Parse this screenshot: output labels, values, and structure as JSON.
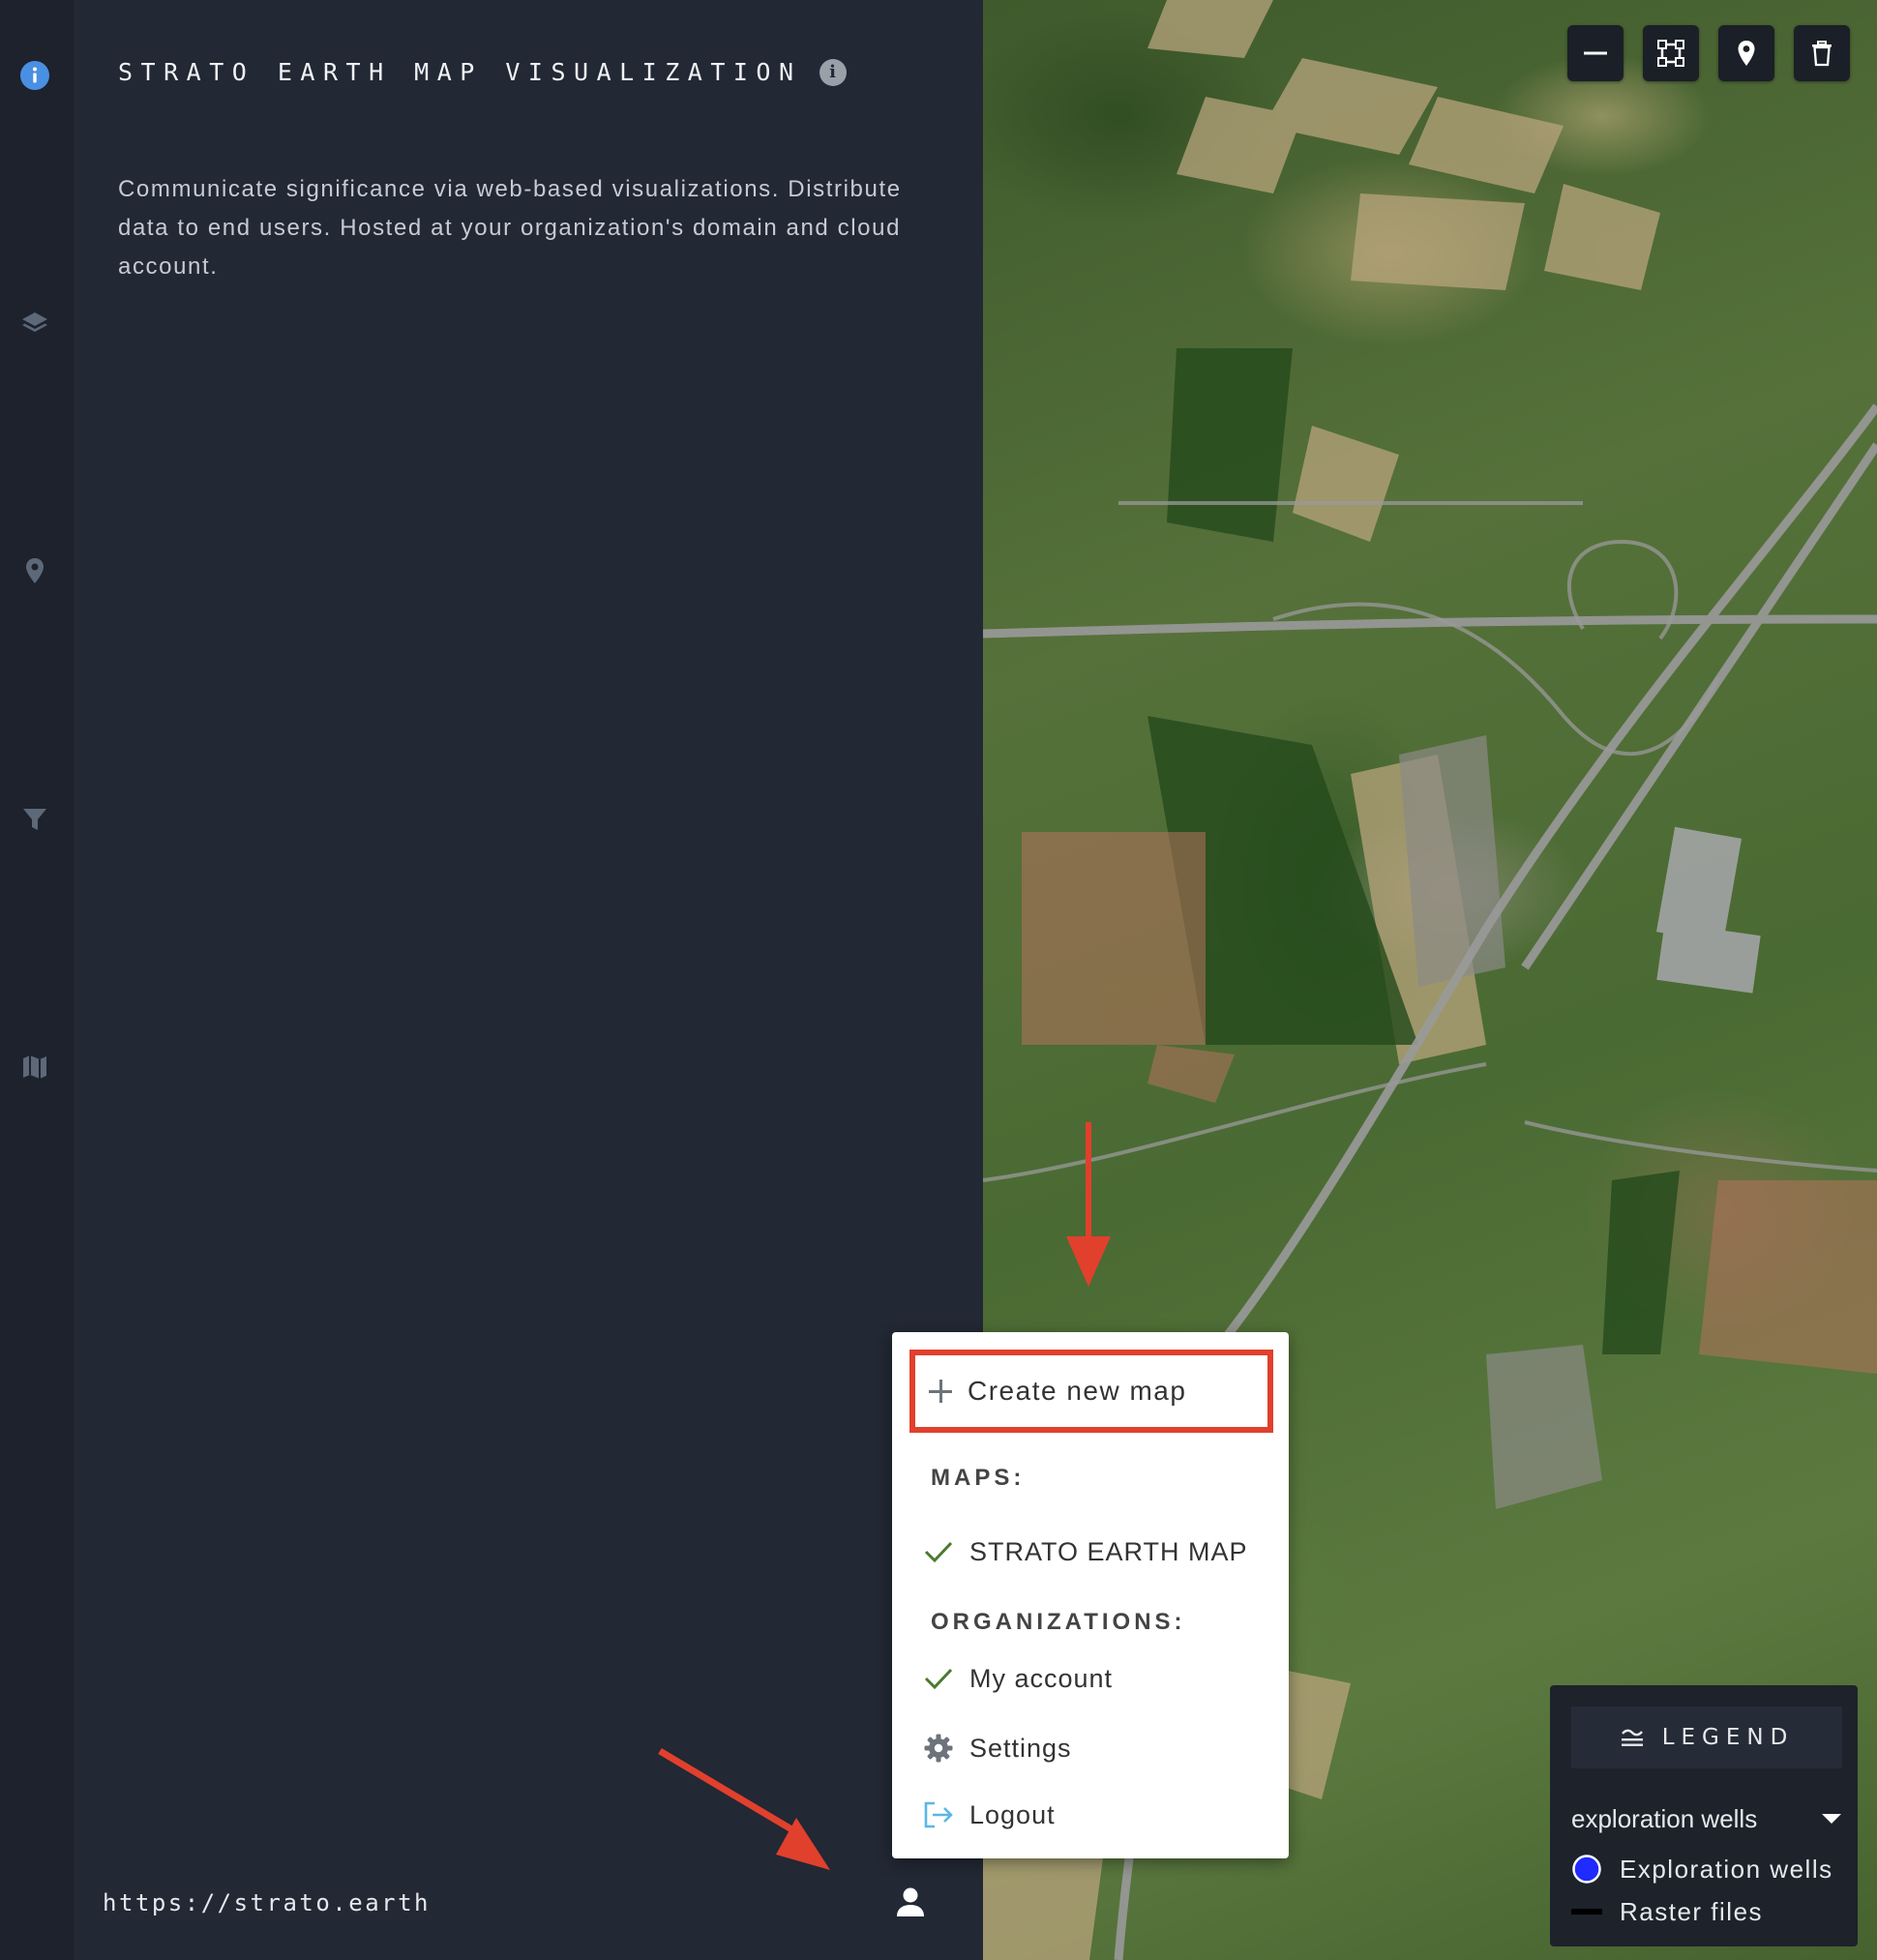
{
  "panel": {
    "title": "STRATO EARTH MAP VISUALIZATION",
    "description": "Communicate significance via web-based visualizations. Distribute data to end users. Hosted at your organization's domain and cloud account.",
    "site_url": "https://strato.earth"
  },
  "rail": {
    "icons": [
      "info-icon",
      "layers-icon",
      "map-pin-icon",
      "filter-icon",
      "map-icon"
    ],
    "active_color": "#4a90e2",
    "inactive_color": "#5d6878"
  },
  "map_toolbar": {
    "icons": [
      "line-draw-icon",
      "polygon-draw-icon",
      "marker-draw-icon",
      "trash-icon"
    ]
  },
  "menu": {
    "create_label": "Create new map",
    "maps_heading": "MAPS:",
    "maps": [
      {
        "label": "STRATO EARTH MAP",
        "checked": true
      }
    ],
    "orgs_heading": "ORGANIZATIONS:",
    "orgs": [
      {
        "label": "My account",
        "checked": true
      }
    ],
    "settings_label": "Settings",
    "logout_label": "Logout",
    "highlight_color": "#e1402d",
    "check_color": "#4a7a2e",
    "logout_icon_color": "#5bb6e8"
  },
  "legend": {
    "title": "LEGEND",
    "selected_layer": "exploration wells",
    "items": [
      {
        "label": "Exploration wells",
        "swatch": "circle",
        "color": "#1f2bff"
      },
      {
        "label": "Raster files",
        "swatch": "line",
        "color": "#000000"
      }
    ]
  }
}
